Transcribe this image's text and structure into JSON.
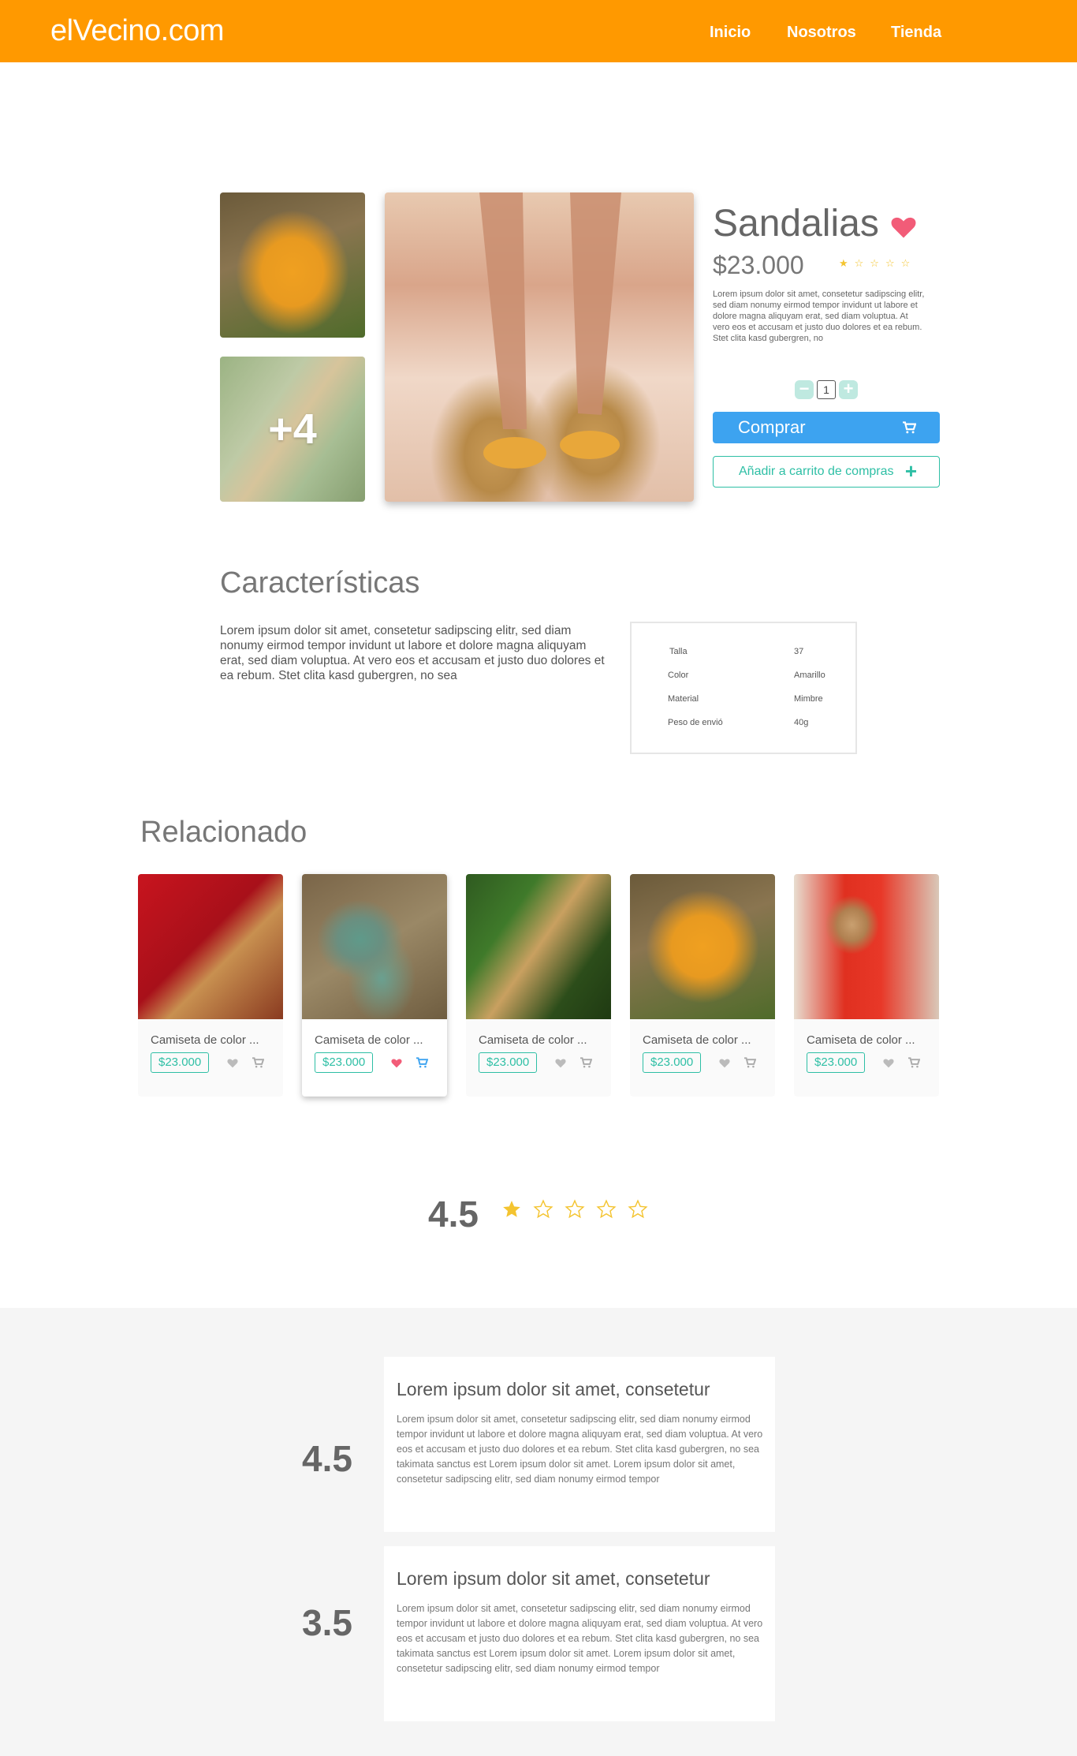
{
  "header": {
    "logo": "elVecino.com",
    "nav": [
      "Inicio",
      "Nosotros",
      "Tienda"
    ],
    "bg_color": "#ff9900"
  },
  "product": {
    "title": "Sandalias",
    "price": "$23.000",
    "favorite": true,
    "mini_rating_stars": "★☆☆☆☆",
    "description": "Lorem ipsum dolor sit amet, consetetur sadipscing elitr, sed diam nonumy eirmod tempor invidunt ut labore et dolore magna aliquyam erat, sed diam voluptua. At vero eos et accusam et justo duo dolores et ea rebum. Stet clita kasd gubergren, no",
    "more_photos_label": "+4",
    "quantity": "1",
    "qty_minus": "−",
    "qty_plus": "+",
    "buy_label": "Comprar",
    "add_to_cart_label": "Añadir a carrito de compras",
    "add_to_cart_icon": "+",
    "accent_blue": "#3da3f0",
    "accent_green": "#2ebfa5"
  },
  "characteristics": {
    "title": "Características",
    "text": "Lorem ipsum dolor sit amet, consetetur sadipscing elitr, sed diam nonumy eirmod tempor invidunt ut labore et dolore magna aliquyam erat, sed diam voluptua. At vero eos et accusam et justo duo dolores et ea rebum. Stet clita kasd gubergren, no sea",
    "specs": [
      {
        "key": "Talla",
        "value": "37"
      },
      {
        "key": "Color",
        "value": "Amarillo"
      },
      {
        "key": "Material",
        "value": "Mimbre"
      },
      {
        "key": "Peso de envió",
        "value": "40g"
      }
    ]
  },
  "related": {
    "title": "Relacionado",
    "items": [
      {
        "name": "Camiseta de color ...",
        "price": "$23.000",
        "favorite": false,
        "active": false
      },
      {
        "name": "Camiseta de color ...",
        "price": "$23.000",
        "favorite": true,
        "active": true
      },
      {
        "name": "Camiseta de color ...",
        "price": "$23.000",
        "favorite": false,
        "active": false
      },
      {
        "name": "Camiseta de color ...",
        "price": "$23.000",
        "favorite": false,
        "active": false
      },
      {
        "name": "Camiseta de color ...",
        "price": "$23.000",
        "favorite": false,
        "active": false
      }
    ]
  },
  "rating": {
    "value": "4.5",
    "filled_stars": 1,
    "total_stars": 5,
    "star_color": "#f4c430"
  },
  "reviews": [
    {
      "score": "4.5",
      "title": "Lorem ipsum dolor sit amet, consetetur",
      "body": "Lorem ipsum dolor sit amet, consetetur sadipscing elitr, sed diam nonumy eirmod tempor invidunt ut labore et dolore magna aliquyam erat, sed diam voluptua. At vero eos et accusam et justo duo dolores et ea rebum. Stet clita kasd gubergren, no sea takimata sanctus est Lorem ipsum dolor sit amet. Lorem ipsum dolor sit amet, consetetur sadipscing elitr, sed diam nonumy eirmod tempor"
    },
    {
      "score": "3.5",
      "title": "Lorem ipsum dolor sit amet, consetetur",
      "body": "Lorem ipsum dolor sit amet, consetetur sadipscing elitr, sed diam nonumy eirmod tempor invidunt ut labore et dolore magna aliquyam erat, sed diam voluptua. At vero eos et accusam et justo duo dolores et ea rebum. Stet clita kasd gubergren, no sea takimata sanctus est Lorem ipsum dolor sit amet. Lorem ipsum dolor sit amet, consetetur sadipscing elitr, sed diam nonumy eirmod tempor"
    }
  ]
}
